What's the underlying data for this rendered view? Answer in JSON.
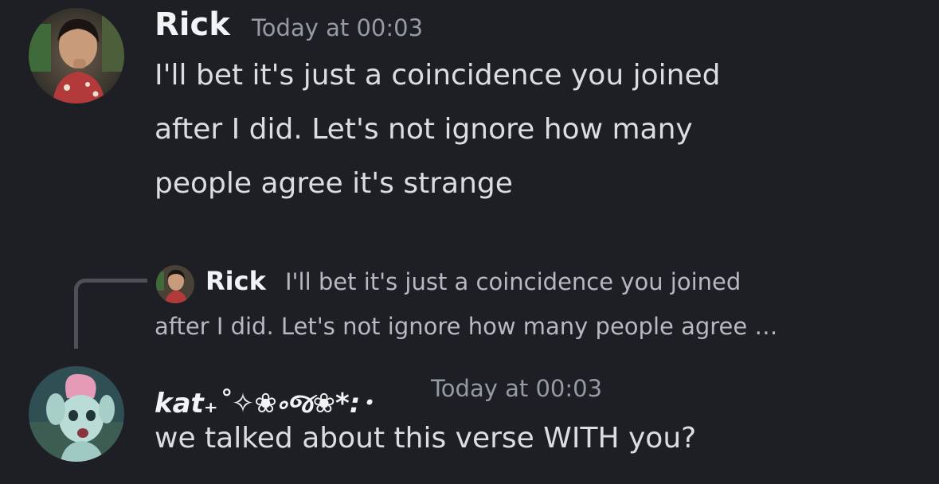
{
  "messages": [
    {
      "author": "Rick",
      "timestamp": "Today at 00:03",
      "lines": [
        "I'll bet it's just a coincidence you joined",
        "after I did. Let's not ignore how many",
        "people agree it's strange"
      ]
    },
    {
      "author": "kat₊˚✧❀༚જ❀*:･",
      "timestamp": "Today at 00:03",
      "reply": {
        "author": "Rick",
        "line1": "I'll bet it's just a coincidence you joined",
        "line2": "after I did. Let's not ignore how many people agree …"
      },
      "lines": [
        "we talked about this verse WITH you?"
      ]
    }
  ],
  "colors": {
    "background": "#1e1f24",
    "username": "#f2f3f5",
    "timestamp": "#949ba4",
    "content": "#dbdee1",
    "reply_text": "#b5bac1",
    "reply_spine": "#4e5058"
  }
}
